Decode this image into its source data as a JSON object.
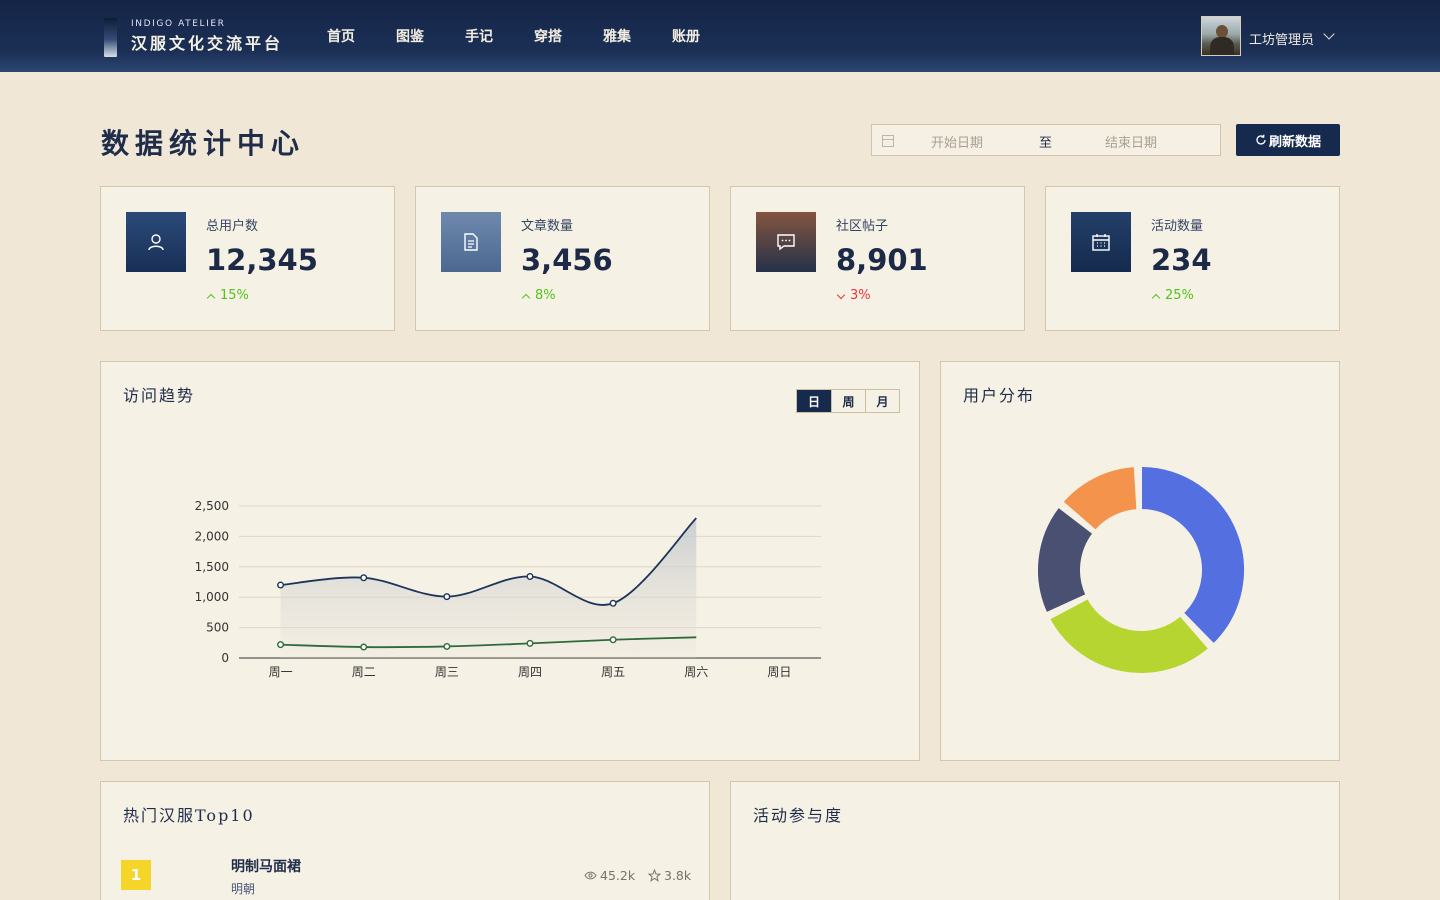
{
  "header": {
    "logo_en": "INDIGO ATELIER",
    "logo_cn": "汉服文化交流平台",
    "nav": [
      "首页",
      "图鉴",
      "手记",
      "穿搭",
      "雅集",
      "账册"
    ],
    "user_name": "工坊管理员"
  },
  "page": {
    "title": "数据统计中心",
    "date_start_placeholder": "开始日期",
    "date_separator": "至",
    "date_end_placeholder": "结束日期",
    "refresh_label": "刷新数据"
  },
  "stats": [
    {
      "label": "总用户数",
      "value": "12,345",
      "trend": "15%",
      "direction": "up",
      "icon": "user-icon",
      "color": "#22416d"
    },
    {
      "label": "文章数量",
      "value": "3,456",
      "trend": "8%",
      "direction": "up",
      "icon": "document-icon",
      "color": "#58749b"
    },
    {
      "label": "社区帖子",
      "value": "8,901",
      "trend": "3%",
      "direction": "down",
      "icon": "chat-icon",
      "color": "#6f4f3e"
    },
    {
      "label": "活动数量",
      "value": "234",
      "trend": "25%",
      "direction": "up",
      "icon": "calendar-icon",
      "color": "#1c3559"
    }
  ],
  "colors": {
    "up": "#52c41a",
    "down": "#e8363a",
    "primary": "#152a4d"
  },
  "visits": {
    "title": "访问趋势",
    "periods": [
      "日",
      "周",
      "月"
    ],
    "active_period": "日"
  },
  "chart_data": [
    {
      "type": "line",
      "categories": [
        "周一",
        "周二",
        "周三",
        "周四",
        "周五",
        "周六",
        "周日"
      ],
      "series": [
        {
          "values": [
            1200,
            1320,
            1010,
            1340,
            900,
            2300,
            null
          ],
          "color": "#1c3559"
        },
        {
          "values": [
            220,
            180,
            190,
            240,
            300,
            340,
            null
          ],
          "color": "#2f6b3a"
        }
      ],
      "yticks": [
        0,
        500,
        1000,
        1500,
        2000,
        2500
      ],
      "ylim": [
        0,
        2500
      ]
    },
    {
      "type": "pie",
      "title": "用户分布",
      "slices": [
        {
          "value": 34,
          "color": "#5470e0"
        },
        {
          "value": 26,
          "color": "#b7d531"
        },
        {
          "value": 16,
          "color": "#4a5072"
        },
        {
          "value": 12,
          "color": "#f4944c"
        }
      ]
    }
  ],
  "top10": {
    "title": "热门汉服Top10",
    "items": [
      {
        "rank": "1",
        "name": "明制马面裙",
        "dynasty": "明朝",
        "views": "45.2k",
        "stars": "3.8k"
      }
    ]
  },
  "activity": {
    "title": "活动参与度"
  }
}
